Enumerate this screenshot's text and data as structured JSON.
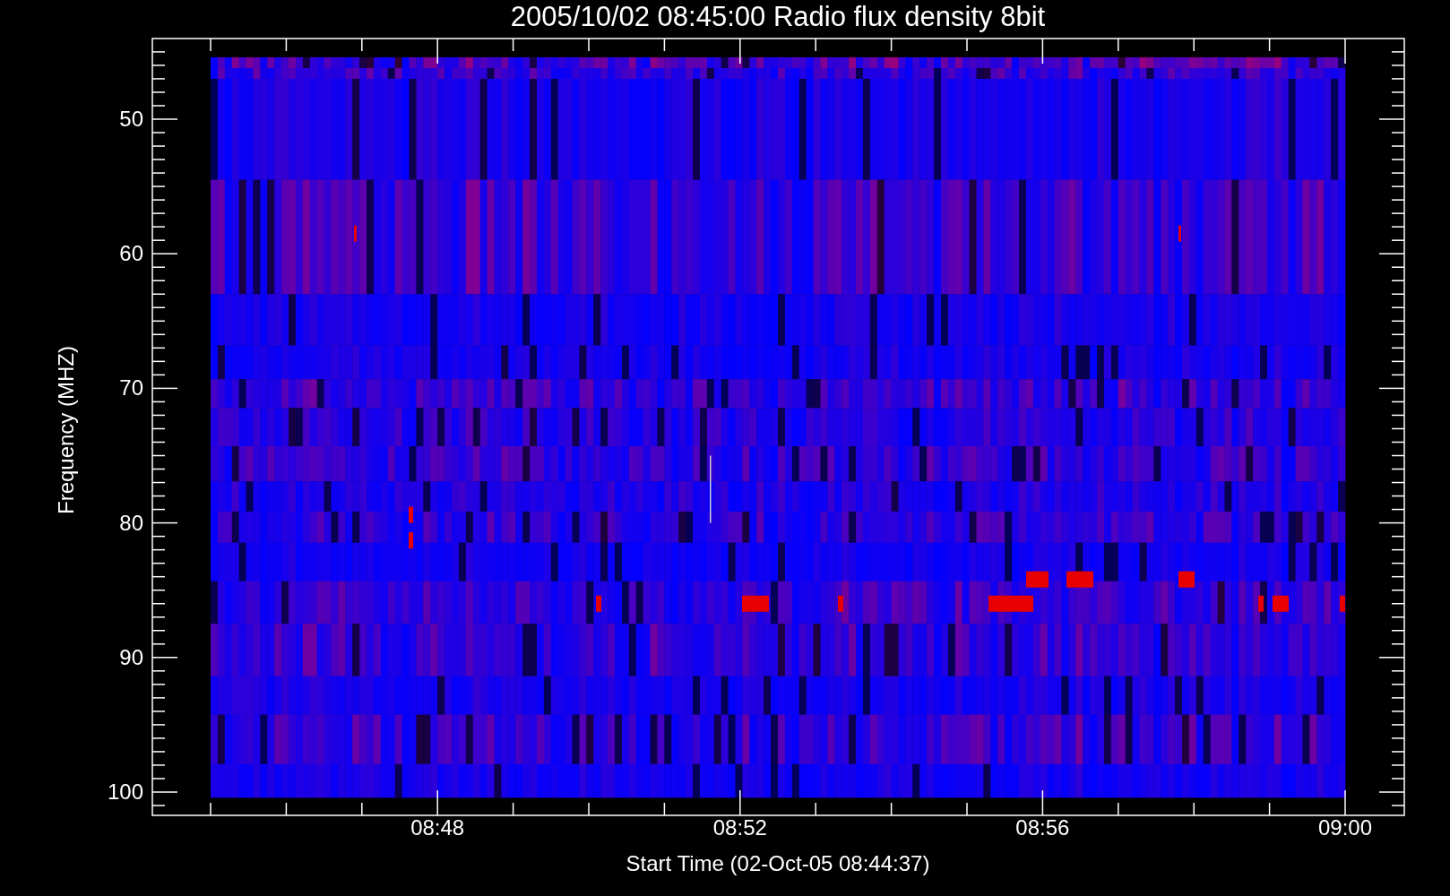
{
  "title": "2005/10/02 08:45:00 Radio flux density 8bit",
  "y_axis": {
    "label": "Frequency (MHZ)",
    "ticks": [
      "50",
      "60",
      "70",
      "80",
      "90",
      "100"
    ]
  },
  "x_axis": {
    "label": "Start Time (02-Oct-05 08:44:37)",
    "ticks": [
      "08:48",
      "08:52",
      "08:56",
      "09:00"
    ]
  }
}
